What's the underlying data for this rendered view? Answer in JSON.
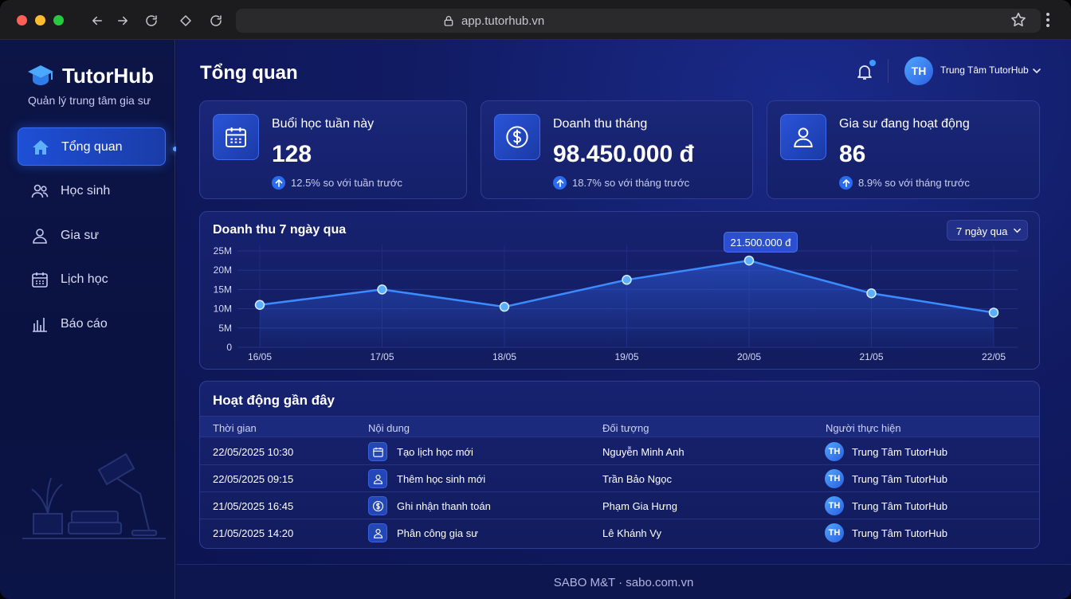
{
  "browser": {
    "url": "app.tutorhub.vn"
  },
  "sidebar": {
    "brand": "TutorHub",
    "tagline": "Quản lý trung tâm gia sư",
    "items": [
      {
        "label": "Tổng quan",
        "icon": "home-icon",
        "active": true
      },
      {
        "label": "Học sinh",
        "icon": "users-icon",
        "active": false
      },
      {
        "label": "Gia sư",
        "icon": "user-icon",
        "active": false
      },
      {
        "label": "Lịch học",
        "icon": "calendar-icon",
        "active": false
      },
      {
        "label": "Báo cáo",
        "icon": "bar-chart-icon",
        "active": false
      }
    ]
  },
  "header": {
    "title": "Tổng quan",
    "user": {
      "initials": "TH",
      "name": "Trung Tâm TutorHub"
    }
  },
  "stats": [
    {
      "title": "Buổi học tuần này",
      "value": "128",
      "trend": "12.5% so với tuần trước",
      "icon": "calendar-icon"
    },
    {
      "title": "Doanh thu tháng",
      "value": "98.450.000 đ",
      "trend": "18.7% so với tháng trước",
      "icon": "dollar-icon"
    },
    {
      "title": "Gia sư đang hoạt động",
      "value": "86",
      "trend": "8.9% so với tháng trước",
      "icon": "user-icon"
    }
  ],
  "chart": {
    "title": "Doanh thu 7 ngày qua",
    "range_label": "7 ngày qua",
    "tooltip": "21.500.000 đ"
  },
  "chart_data": {
    "type": "area",
    "categories": [
      "16/05",
      "17/05",
      "18/05",
      "19/05",
      "20/05",
      "21/05",
      "22/05"
    ],
    "values": [
      11000000,
      15000000,
      10500000,
      17500000,
      22500000,
      14000000,
      9000000
    ],
    "y_ticks": [
      "0",
      "5M",
      "10M",
      "15M",
      "20M",
      "25M"
    ],
    "ylim": [
      0,
      25000000
    ],
    "grid": true,
    "colors": {
      "line": "#3b8bff",
      "fill": "#2a5ad8"
    }
  },
  "activity": {
    "title": "Hoạt động gần đây",
    "columns": [
      "Thời gian",
      "Nội dung",
      "Đối tượng",
      "Người thực hiện"
    ],
    "rows": [
      {
        "time": "22/05/2025 10:30",
        "content": "Tạo lịch học mới",
        "icon": "calendar-icon",
        "target": "Nguyễn Minh Anh",
        "actor_initials": "TH",
        "actor": "Trung Tâm TutorHub"
      },
      {
        "time": "22/05/2025 09:15",
        "content": "Thêm học sinh mới",
        "icon": "user-icon",
        "target": "Trần Bảo Ngọc",
        "actor_initials": "TH",
        "actor": "Trung Tâm TutorHub"
      },
      {
        "time": "21/05/2025 16:45",
        "content": "Ghi nhận thanh toán",
        "icon": "dollar-icon",
        "target": "Phạm Gia Hưng",
        "actor_initials": "TH",
        "actor": "Trung Tâm TutorHub"
      },
      {
        "time": "21/05/2025 14:20",
        "content": "Phân công gia sư",
        "icon": "user-icon",
        "target": "Lê Khánh Vy",
        "actor_initials": "TH",
        "actor": "Trung Tâm TutorHub"
      }
    ]
  },
  "footer": {
    "text": "SABO M&T · sabo.com.vn"
  }
}
